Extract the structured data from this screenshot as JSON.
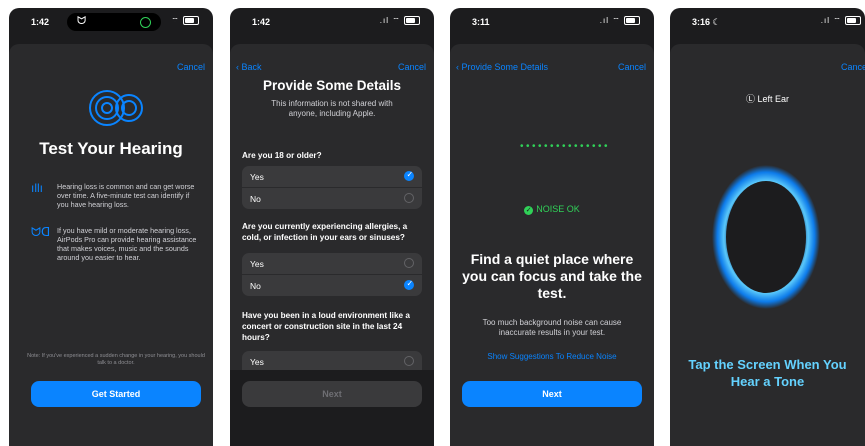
{
  "screens": [
    {
      "time": "1:42",
      "cancel": "Cancel",
      "title": "Test Your Hearing",
      "rows": [
        {
          "icon": "waveform-icon",
          "text": "Hearing loss is common and can get worse over time. A five-minute test can identify if you have hearing loss."
        },
        {
          "icon": "airpods-icon",
          "text": "If you have mild or moderate hearing loss, AirPods Pro can provide hearing assistance that makes voices, music and the sounds around you easier to hear."
        }
      ],
      "note": "Note: If you've experienced a sudden change in your hearing, you should talk to a doctor.",
      "button": "Get Started"
    },
    {
      "time": "1:42",
      "back": "Back",
      "cancel": "Cancel",
      "title": "Provide Some Details",
      "subtitle": "This information is not shared with anyone, including Apple.",
      "questions": [
        {
          "q": "Are you 18 or older?",
          "options": [
            {
              "label": "Yes",
              "selected": true
            },
            {
              "label": "No",
              "selected": false
            }
          ]
        },
        {
          "q": "Are you currently experiencing allergies, a cold, or infection in your ears or sinuses?",
          "options": [
            {
              "label": "Yes",
              "selected": false
            },
            {
              "label": "No",
              "selected": true
            }
          ]
        },
        {
          "q": "Have you been in a loud environment like a concert or construction site in the last 24 hours?",
          "options": [
            {
              "label": "Yes",
              "selected": false
            }
          ]
        }
      ],
      "button": "Next"
    },
    {
      "time": "3:11",
      "back": "Provide Some Details",
      "cancel": "Cancel",
      "noise": "NOISE OK",
      "heading": "Find a quiet place where you can focus and take the test.",
      "body": "Too much background noise can cause inaccurate results in your test.",
      "link": "Show Suggestions To Reduce Noise",
      "button": "Next"
    },
    {
      "time": "3:16",
      "cancel": "Cancel",
      "ear": "Left Ear",
      "instruction": "Tap the Screen When You Hear a Tone"
    }
  ],
  "colors": {
    "accent": "#0a84ff",
    "ok": "#30d158",
    "tone": "#64d2ff"
  }
}
